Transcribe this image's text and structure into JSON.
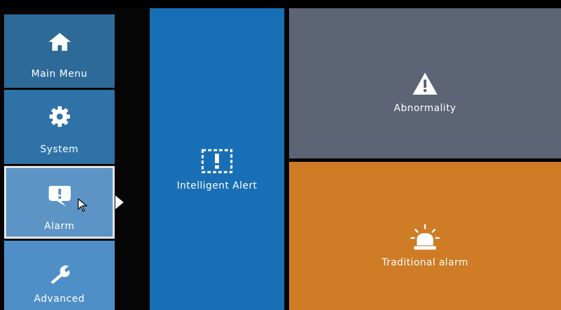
{
  "sidebar": {
    "items": [
      {
        "label": "Main Menu",
        "icon": "home-icon",
        "selected": false
      },
      {
        "label": "System",
        "icon": "gear-icon",
        "selected": false
      },
      {
        "label": "Alarm",
        "icon": "alarm-exclamation-icon",
        "selected": true
      },
      {
        "label": "Advanced",
        "icon": "wrench-icon",
        "selected": false
      }
    ]
  },
  "tiles": {
    "intelligent": {
      "label": "Intelligent Alert",
      "icon": "intelligent-alert-icon",
      "color": "#196fb5"
    },
    "abnormality": {
      "label": "Abnormality",
      "icon": "warning-triangle-icon",
      "color": "#5d6476"
    },
    "traditional": {
      "label": "Traditional alarm",
      "icon": "siren-icon",
      "color": "#cf7c26"
    }
  },
  "colors": {
    "background": "#000000",
    "selected_border": "#e6e6e6"
  }
}
